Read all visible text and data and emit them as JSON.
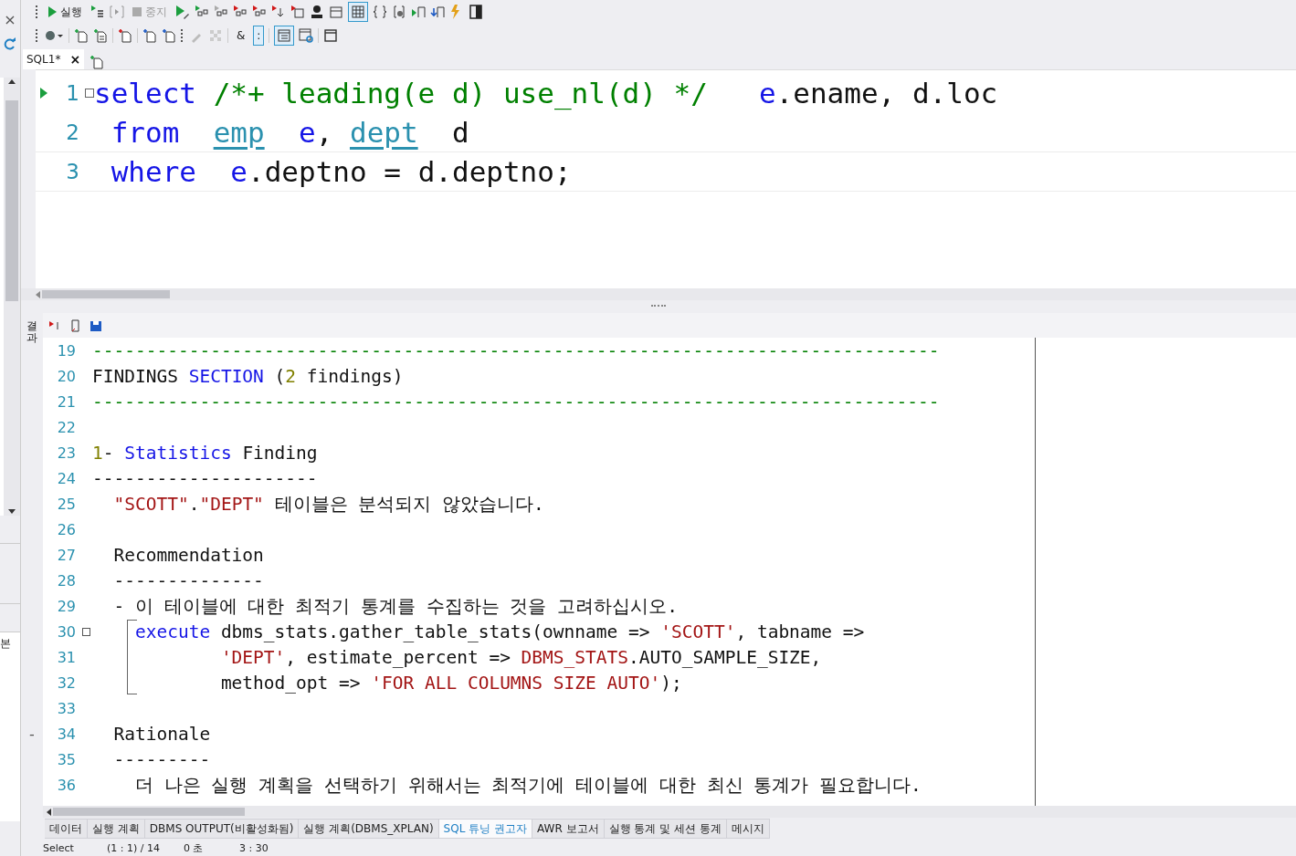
{
  "left_panel": {
    "close": "×",
    "column_fragment": "본"
  },
  "toolbar": {
    "run_label": "실행",
    "stop_label": "중지",
    "stop_disabled": true,
    "grid_selected": true,
    "amp_label": "&",
    "colon_label": ":",
    "colon_selected": true,
    "layout_selected": true
  },
  "editor_tabs": [
    {
      "label": "SQL1*",
      "close": "×",
      "selected": true
    }
  ],
  "editor": {
    "lines": [
      {
        "number": "1",
        "current": true,
        "fold": true,
        "tokens": [
          {
            "text": "select",
            "kind": "keyword"
          },
          {
            "text": " /*+ leading(e d) use_nl(d) */",
            "kind": "comment"
          },
          {
            "text": "   e",
            "kind": "alias"
          },
          {
            "text": ".ename, d.loc",
            "kind": "plain"
          }
        ]
      },
      {
        "number": "2",
        "current": false,
        "fold": false,
        "tokens": [
          {
            "text": " from",
            "kind": "keyword"
          },
          {
            "text": "  emp",
            "kind": "table"
          },
          {
            "text": "  e",
            "kind": "alias"
          },
          {
            "text": ", ",
            "kind": "plain"
          },
          {
            "text": "dept",
            "kind": "table"
          },
          {
            "text": "  d",
            "kind": "plain"
          }
        ]
      },
      {
        "number": "3",
        "current": false,
        "fold": false,
        "tokens": [
          {
            "text": " where",
            "kind": "keyword"
          },
          {
            "text": "  e",
            "kind": "alias"
          },
          {
            "text": ".deptno = d.deptno;",
            "kind": "plain"
          }
        ]
      }
    ]
  },
  "results": {
    "label": "결과",
    "lines": [
      {
        "number": "19",
        "fold": false,
        "tokens": [
          {
            "text": "-------------------------------------------------------------------------------",
            "kind": "comment"
          }
        ]
      },
      {
        "number": "20",
        "fold": false,
        "tokens": [
          {
            "text": "FINDINGS ",
            "kind": "plain"
          },
          {
            "text": "SECTION",
            "kind": "keyword"
          },
          {
            "text": " (",
            "kind": "plain"
          },
          {
            "text": "2",
            "kind": "number"
          },
          {
            "text": " findings)",
            "kind": "plain"
          }
        ]
      },
      {
        "number": "21",
        "fold": false,
        "tokens": [
          {
            "text": "-------------------------------------------------------------------------------",
            "kind": "comment"
          }
        ]
      },
      {
        "number": "22",
        "fold": false
      },
      {
        "number": "23",
        "fold": false,
        "tokens": [
          {
            "text": "1",
            "kind": "number"
          },
          {
            "text": "- ",
            "kind": "plain"
          },
          {
            "text": "Statistics",
            "kind": "keyword"
          },
          {
            "text": " Finding",
            "kind": "plain"
          }
        ]
      },
      {
        "number": "24",
        "fold": false,
        "tokens": [
          {
            "text": "---------------------",
            "kind": "plain"
          }
        ]
      },
      {
        "number": "25",
        "fold": false,
        "tokens": [
          {
            "text": "  \"SCOTT\"",
            "kind": "string"
          },
          {
            "text": ".",
            "kind": "plain"
          },
          {
            "text": "\"DEPT\"",
            "kind": "string"
          },
          {
            "text": " 테이블은 분석되지 않았습니다.",
            "kind": "plain"
          }
        ]
      },
      {
        "number": "26",
        "fold": false
      },
      {
        "number": "27",
        "fold": false,
        "tokens": [
          {
            "text": "  Recommendation",
            "kind": "plain"
          }
        ]
      },
      {
        "number": "28",
        "fold": false,
        "tokens": [
          {
            "text": "  --------------",
            "kind": "plain"
          }
        ]
      },
      {
        "number": "29",
        "fold": false,
        "tokens": [
          {
            "text": "  - 이 테이블에 대한 최적기 통계를 수집하는 것을 고려하십시오.",
            "kind": "plain"
          }
        ]
      },
      {
        "number": "30",
        "fold": true,
        "tokens": [
          {
            "text": "    execute",
            "kind": "keyword"
          },
          {
            "text": " dbms_stats.gather_table_stats(ownname => ",
            "kind": "plain"
          },
          {
            "text": "'SCOTT'",
            "kind": "string"
          },
          {
            "text": ", tabname =>",
            "kind": "plain"
          }
        ]
      },
      {
        "number": "31",
        "fold": false,
        "tokens": [
          {
            "text": "            'DEPT'",
            "kind": "string"
          },
          {
            "text": ", estimate_percent => ",
            "kind": "plain"
          },
          {
            "text": "DBMS_STATS",
            "kind": "string"
          },
          {
            "text": ".AUTO_SAMPLE_SIZE,",
            "kind": "plain"
          }
        ]
      },
      {
        "number": "32",
        "fold": false,
        "tokens": [
          {
            "text": "            method_opt => ",
            "kind": "plain"
          },
          {
            "text": "'FOR ALL COLUMNS SIZE AUTO'",
            "kind": "string"
          },
          {
            "text": ");",
            "kind": "plain"
          }
        ]
      },
      {
        "number": "33",
        "fold": false
      },
      {
        "number": "34",
        "fold": false,
        "tokens": [
          {
            "text": "  Rationale",
            "kind": "plain"
          }
        ]
      },
      {
        "number": "35",
        "fold": false,
        "tokens": [
          {
            "text": "  ---------",
            "kind": "plain"
          }
        ]
      },
      {
        "number": "36",
        "fold": false,
        "tokens": [
          {
            "text": "    더 나은 실행 계획을 선택하기 위해서는 최적기에 테이블에 대한 최신 통계가 필요합니다.",
            "kind": "plain"
          }
        ]
      }
    ]
  },
  "result_tabs": [
    {
      "label": "데이터",
      "selected": false
    },
    {
      "label": "실행 계획",
      "selected": false
    },
    {
      "label": "DBMS OUTPUT(비활성화됨)",
      "selected": false
    },
    {
      "label": "실행 계획(DBMS_XPLAN)",
      "selected": false
    },
    {
      "label": "SQL 튜닝 권고자",
      "selected": true
    },
    {
      "label": "AWR 보고서",
      "selected": false
    },
    {
      "label": "실행 통계 및 세션 통계",
      "selected": false
    },
    {
      "label": "메시지",
      "selected": false
    }
  ],
  "status_bar": {
    "mode": "Select",
    "position": "(1 : 1) / 14",
    "elapsed": "0 초",
    "time": "3 : 30"
  },
  "side_marker": "-"
}
